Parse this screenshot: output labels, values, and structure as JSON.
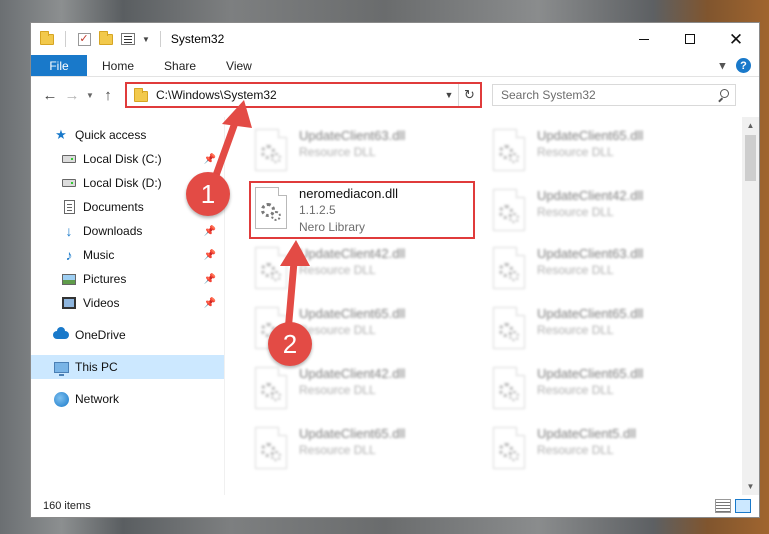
{
  "window": {
    "title": "System32"
  },
  "ribbon": {
    "tabs": [
      "File",
      "Home",
      "Share",
      "View"
    ],
    "help": "?"
  },
  "navbar": {
    "address": "C:\\Windows\\System32",
    "search_placeholder": "Search System32"
  },
  "sidebar": {
    "items": [
      {
        "label": "Quick access",
        "icon": "star-icon"
      },
      {
        "label": "Local Disk (C:)",
        "icon": "drive-icon",
        "pinned": true
      },
      {
        "label": "Local Disk (D:)",
        "icon": "drive-icon"
      },
      {
        "label": "Documents",
        "icon": "document-icon"
      },
      {
        "label": "Downloads",
        "icon": "download-icon",
        "pinned": true
      },
      {
        "label": "Music",
        "icon": "music-icon",
        "pinned": true
      },
      {
        "label": "Pictures",
        "icon": "pictures-icon",
        "pinned": true
      },
      {
        "label": "Videos",
        "icon": "videos-icon",
        "pinned": true
      },
      {
        "label": "OneDrive",
        "icon": "cloud-icon"
      },
      {
        "label": "This PC",
        "icon": "computer-icon",
        "selected": true
      },
      {
        "label": "Network",
        "icon": "network-icon"
      }
    ]
  },
  "files": {
    "highlighted": {
      "name": "neromediacon.dll",
      "version": "1.1.2.5",
      "description": "Nero Library"
    },
    "blurred": [
      {
        "name": "UpdateClient63.dll",
        "sub": "Resource DLL"
      },
      {
        "name": "UpdateClient65.dll",
        "sub": "Resource DLL"
      },
      {
        "name": "UpdateClient42.dll",
        "sub": "Resource DLL"
      },
      {
        "name": "UpdateClient42.dll",
        "sub": "Resource DLL"
      },
      {
        "name": "UpdateClient63.dll",
        "sub": "Resource DLL"
      },
      {
        "name": "UpdateClient65.dll",
        "sub": "Resource DLL"
      },
      {
        "name": "UpdateClient65.dll",
        "sub": "Resource DLL"
      },
      {
        "name": "UpdateClient42.dll",
        "sub": "Resource DLL"
      },
      {
        "name": "UpdateClient65.dll",
        "sub": "Resource DLL"
      },
      {
        "name": "UpdateClient65.dll",
        "sub": "Resource DLL"
      },
      {
        "name": "UpdateClient5.dll",
        "sub": "Resource DLL"
      }
    ]
  },
  "status": {
    "count": "160 items"
  },
  "annotations": {
    "marker1": "1",
    "marker2": "2",
    "color": "#e34b45"
  },
  "colors": {
    "accent": "#1979ca",
    "highlight_border": "#e03b3b",
    "selection": "#cce8ff"
  }
}
